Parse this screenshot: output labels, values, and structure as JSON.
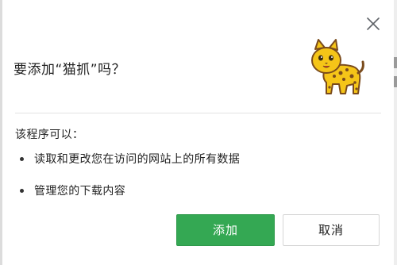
{
  "dialog": {
    "title": "要添加“猫抓”吗？",
    "close_label": "×",
    "permissions_heading": "该程序可以：",
    "permissions": [
      "读取和更改您在访问的网站上的所有数据",
      "管理您的下载内容"
    ],
    "add_button": "添加",
    "cancel_button": "取消"
  },
  "colors": {
    "add_button_bg": "#34a853",
    "logo_body": "#f5c518",
    "logo_spots": "#7a4b1c"
  },
  "icons": {
    "close": "close-icon",
    "logo": "cat-logo-icon"
  }
}
